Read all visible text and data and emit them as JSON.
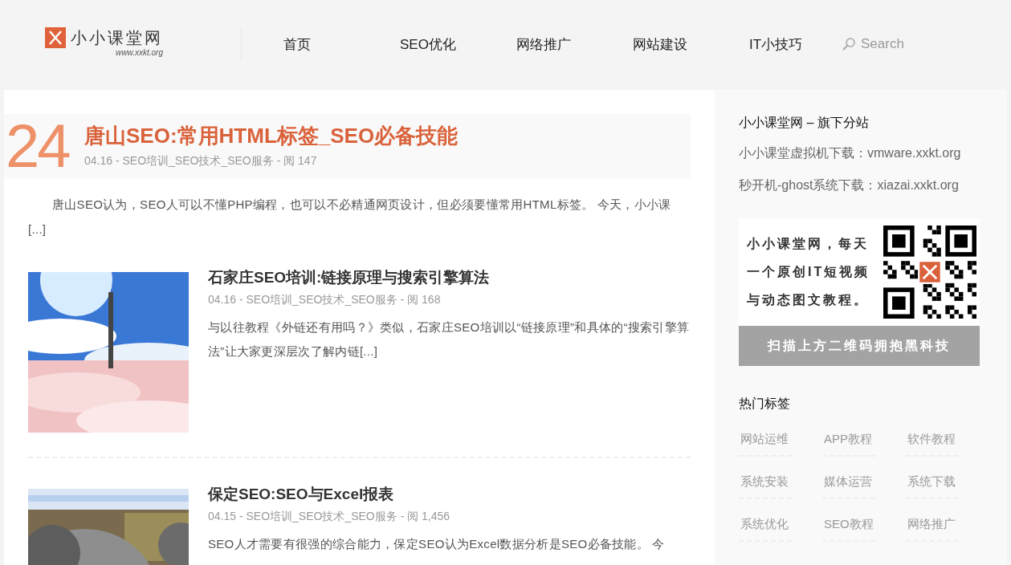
{
  "header": {
    "logo": {
      "name": "小小课堂网",
      "url": "www.xxkt.org"
    },
    "nav": [
      {
        "label": "首页",
        "selected": false
      },
      {
        "label": "SEO优化",
        "selected": false
      },
      {
        "label": "网络推广",
        "selected": false
      },
      {
        "label": "网站建设",
        "selected": false
      },
      {
        "label": "IT小技巧",
        "selected": false
      }
    ],
    "search": {
      "placeholder": "Search"
    }
  },
  "featured": {
    "day": "24",
    "title": "唐山SEO:常用HTML标签_SEO必备技能",
    "meta": "04.16 - SEO培训_SEO技术_SEO服务 - 阅 147",
    "excerpt": "唐山SEO认为，SEO人可以不懂PHP编程，也可以不必精通网页设计，但必须要懂常用HTML标签。 今天，小小课",
    "more": "[...]"
  },
  "posts": [
    {
      "title": "石家庄SEO培训:链接原理与搜索引擎算法",
      "meta": "04.16 - SEO培训_SEO技术_SEO服务 - 阅 168",
      "excerpt": "与以往教程《外链还有用吗？》类似，石家庄SEO培训以“链接原理”和具体的“搜索引擎算法”让大家更深层次了解内链",
      "more": "[...]"
    },
    {
      "title": "保定SEO:SEO与Excel报表",
      "meta": "04.15 - SEO培训_SEO技术_SEO服务 - 阅 1,456",
      "excerpt": "SEO人才需要有很强的综合能力，保定SEO认为Excel数据分析是SEO必备技能。 今"
    }
  ],
  "sidebar": {
    "sites": {
      "title": "小小课堂网 – 旗下分站",
      "links": [
        "小小课堂虚拟机下载：vmware.xxkt.org",
        "秒开机-ghost系统下载：xiazai.xxkt.org"
      ]
    },
    "promo": {
      "lines": [
        "小小课堂网，每天",
        "一个原创IT短视频",
        "与动态图文教程。"
      ],
      "caption": "扫描上方二维码拥抱黑科技"
    },
    "tags": {
      "title": "热门标签",
      "items": [
        "网站运维",
        "APP教程",
        "软件教程",
        "系统安装",
        "媒体运营",
        "系统下载",
        "系统优化",
        "SEO教程",
        "网络推广"
      ]
    }
  }
}
